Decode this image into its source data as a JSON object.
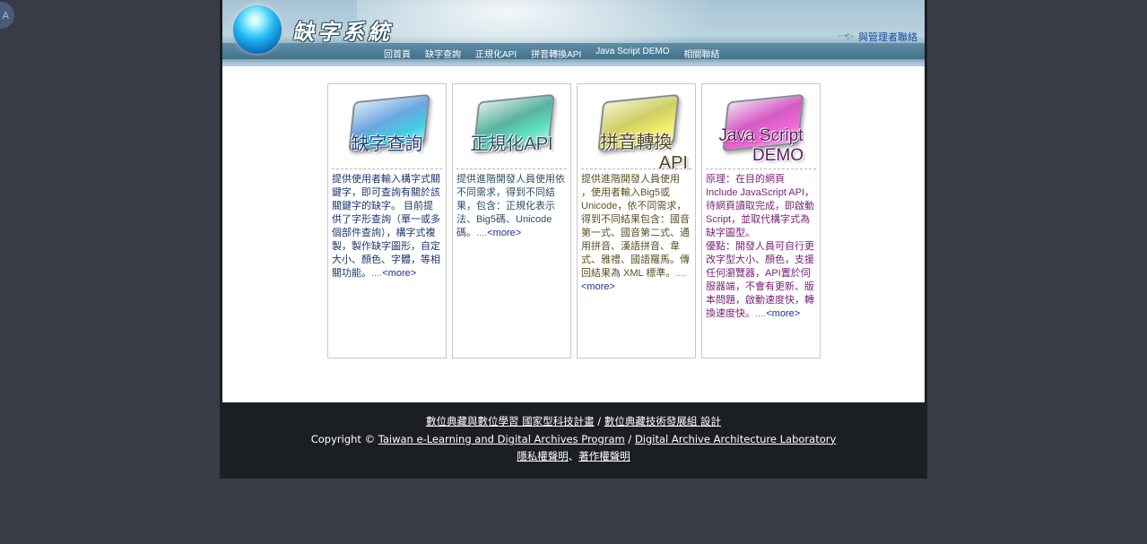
{
  "corner_badge": "A",
  "header": {
    "title": "缺字系統",
    "contact_link": "與管理者聯絡",
    "nav": [
      "回首頁",
      "缺字查詢",
      "正規化API",
      "拼音轉換API",
      "Java Script DEMO",
      "相關聯結"
    ]
  },
  "cards": [
    {
      "logo_line1": "缺字查詢",
      "logo_line2": "",
      "text": "提供使用者輸入構字式關鍵字，即可查詢有關於該關鍵字的缺字。 目前提供了字形查詢（單一或多個部件查詢），構字式複製，製作缺字圖形，自定大小、顏色、字體，等相關功能。",
      "dots": "....",
      "more": "<more>"
    },
    {
      "logo_line1": "正規化API",
      "logo_line2": "",
      "text": "提供進階開發人員使用依不同需求，得到不同結果，包含：正規化表示法、Big5碼、Unicode碼。",
      "dots": "....",
      "more": "<more>"
    },
    {
      "logo_line1": "拼音轉換",
      "logo_line2": "API",
      "text": "提供進階開發人員使用 ，使用者輸入Big5或Unicode，依不同需求，得到不同結果包含：國音第一式、國音第二式、通用拼音、漢語拼音、韋式、雅禮、國語羅馬。傳回結果為 XML 標準。",
      "dots": "....",
      "more": "<more>"
    },
    {
      "logo_line1": "Java Script",
      "logo_line2": "DEMO",
      "text": "原理：在目的網頁Include JavaScript API，待網頁讀取完成，即啟動Script，並取代構字式為缺字圖型。",
      "text2": "優點：開發人員可自行更改字型大小、顏色，支援任何瀏覽器，API置於伺服器端，不會有更新、版本問題，啟動速度快，轉換速度快。",
      "dots": "....",
      "more": "<more>"
    }
  ],
  "footer": {
    "line1_a": "數位典藏與數位學習 國家型科技計畫",
    "line1_sep": " / ",
    "line1_b": "數位典藏技術發展組 設計",
    "line2_prefix": "Copyright © ",
    "line2_a": "Taiwan e-Learning and Digital Archives Program",
    "line2_sep": " / ",
    "line2_b": "Digital Archive Architecture Laboratory",
    "line3_a": "隱私權聲明",
    "line3_sep": "、",
    "line3_b": "著作權聲明"
  }
}
